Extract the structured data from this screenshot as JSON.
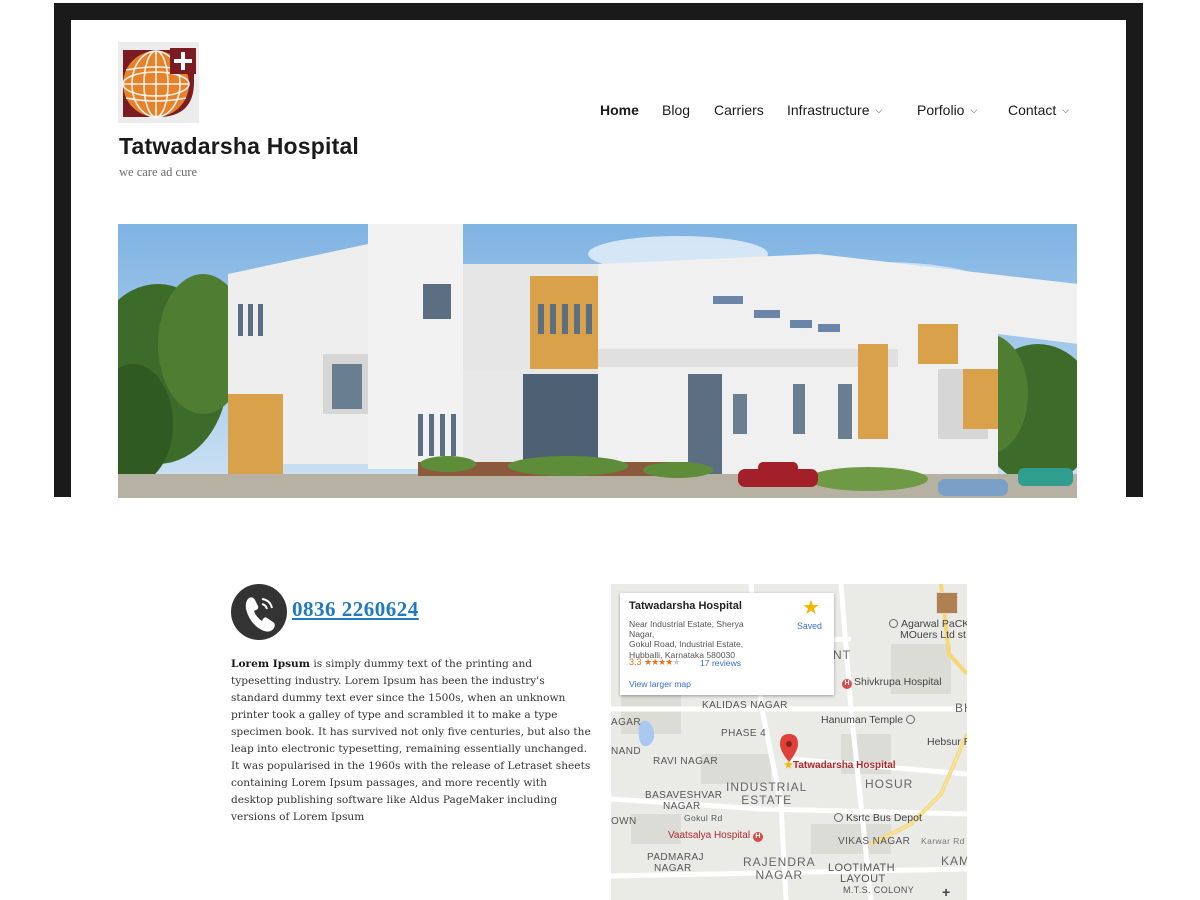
{
  "site": {
    "title": "Tatwadarsha Hospital",
    "tagline": "we care ad cure"
  },
  "nav": {
    "items": [
      {
        "label": "Home",
        "active": true,
        "has_submenu": false
      },
      {
        "label": "Blog",
        "active": false,
        "has_submenu": false
      },
      {
        "label": "Carriers",
        "active": false,
        "has_submenu": false
      },
      {
        "label": "Infrastructure",
        "active": false,
        "has_submenu": true
      },
      {
        "label": "Porfolio",
        "active": false,
        "has_submenu": true
      },
      {
        "label": "Contact",
        "active": false,
        "has_submenu": true
      }
    ]
  },
  "contact": {
    "phone": "0836 2260624",
    "body_bold": "Lorem Ipsum",
    "body_text": " is simply dummy text of the printing and typesetting industry. Lorem Ipsum has been the industry's standard dummy text ever since the 1500s, when an unknown printer took a galley of type and scrambled it to make a type specimen book. It has survived not only five centuries, but also the leap into electronic typesetting, remaining essentially unchanged. It was popularised in the 1960s with the release of Letraset sheets containing Lorem Ipsum passages, and more recently with desktop publishing software like Aldus PageMaker including versions of Lorem Ipsum"
  },
  "map": {
    "card": {
      "title": "Tatwadarsha Hospital",
      "address_line1": "Near Industrial Estate, Sherya Nagar,",
      "address_line2": "Gokul Road, Industrial Estate,",
      "address_line3": "Hubballi, Karnataka 580030",
      "rating": "3.3",
      "rating_value": 3.3,
      "reviews": "17 reviews",
      "larger_map": "View larger map",
      "saved": "Saved"
    },
    "labels": {
      "agarwal_1": "Agarwal PaCK",
      "agarwal_2": "MOuers Ltd st",
      "nt": "NT",
      "shivkrupa": "Shivkrupa Hospital",
      "bh": "BH",
      "kalidas": "KALIDAS NAGAR",
      "hanuman": "Hanuman Temple",
      "agar": "AGAR",
      "phase4": "PHASE 4",
      "hebsur": "Hebsur R",
      "nand": "NAND",
      "ravi": "RAVI NAGAR",
      "pin_label": "Tatwadarsha Hospital",
      "industrial_1": "INDUSTRIAL",
      "industrial_2": "ESTATE",
      "hosur": "HOSUR",
      "basaveshvar_1": "BASAVESHVAR",
      "basaveshvar_2": "NAGAR",
      "gokul": "Gokul Rd",
      "own": "OWN",
      "ksrtc": "Ksrtc Bus Depot",
      "vaatsalya": "Vaatsalya Hospital",
      "karwar": "Karwar Rd",
      "vikas": "VIKAS NAGAR",
      "padmaraj_1": "PADMARAJ",
      "padmaraj_2": "NAGAR",
      "rajendra_1": "RAJENDRA",
      "rajendra_2": "NAGAR",
      "lootimath_1": "LOOTIMATH",
      "lootimath_2": "LAYOUT",
      "kam": "KAM",
      "mts": "M.T.S. COLONY",
      "zoom_in": "+"
    }
  },
  "colors": {
    "frame": "#1a1a1a",
    "link": "#1f7ac1",
    "logo_orange": "#e8822a",
    "logo_maroon": "#7a1c22"
  }
}
